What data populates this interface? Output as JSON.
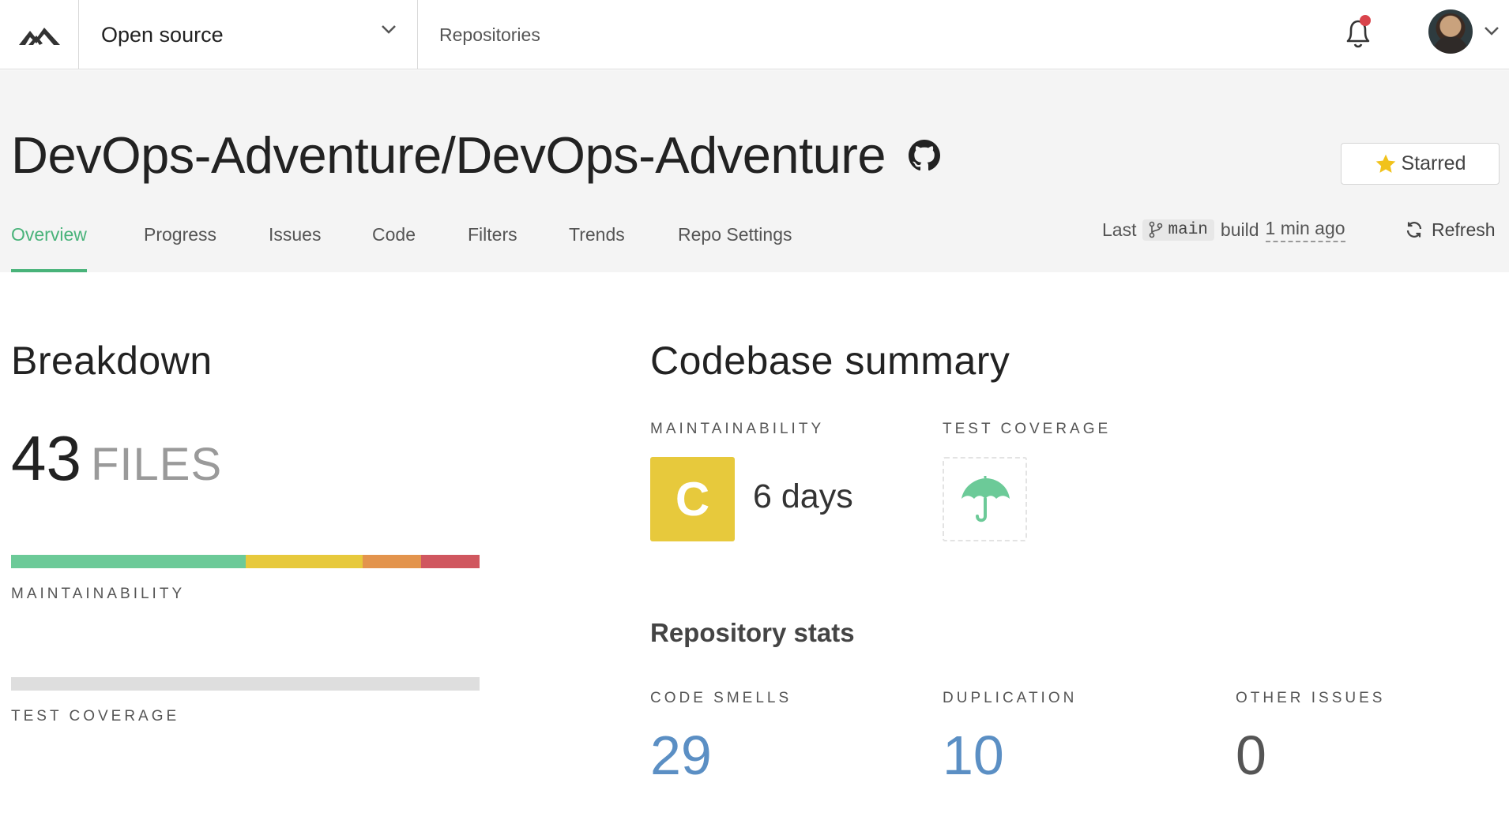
{
  "topbar": {
    "org_name": "Open source",
    "nav_link": "Repositories"
  },
  "repo": {
    "title": "DevOps-Adventure/DevOps-Adventure",
    "star_label": "Starred"
  },
  "tabs": [
    {
      "label": "Overview",
      "active": true
    },
    {
      "label": "Progress"
    },
    {
      "label": "Issues"
    },
    {
      "label": "Code"
    },
    {
      "label": "Filters"
    },
    {
      "label": "Trends"
    },
    {
      "label": "Repo Settings"
    }
  ],
  "build": {
    "prefix": "Last",
    "branch": "main",
    "middle": "build",
    "time": "1 min ago",
    "refresh_label": "Refresh"
  },
  "breakdown": {
    "title": "Breakdown",
    "file_count": "43",
    "file_unit": "FILES",
    "maintainability_label": "MAINTAINABILITY",
    "test_coverage_label": "TEST COVERAGE",
    "maintainability_distribution": [
      {
        "grade": "A-B",
        "fraction": 0.5,
        "color": "#6cca98"
      },
      {
        "grade": "C",
        "fraction": 0.25,
        "color": "#e7c93c"
      },
      {
        "grade": "D",
        "fraction": 0.125,
        "color": "#e3944d"
      },
      {
        "grade": "E-F",
        "fraction": 0.125,
        "color": "#d0575f"
      }
    ]
  },
  "summary": {
    "title": "Codebase summary",
    "maintainability_label": "MAINTAINABILITY",
    "grade": "C",
    "grade_color": "#e7c93c",
    "debt": "6 days",
    "test_coverage_label": "TEST COVERAGE",
    "coverage_icon": "umbrella-icon",
    "stats_title": "Repository stats",
    "stats": [
      {
        "label": "CODE SMELLS",
        "value": "29",
        "color": "#5b8fc4"
      },
      {
        "label": "DUPLICATION",
        "value": "10",
        "color": "#5b8fc4"
      },
      {
        "label": "OTHER ISSUES",
        "value": "0",
        "color": "#555555"
      }
    ]
  },
  "colors": {
    "accent_green": "#49b37a",
    "notification_dot": "#d9434b"
  }
}
